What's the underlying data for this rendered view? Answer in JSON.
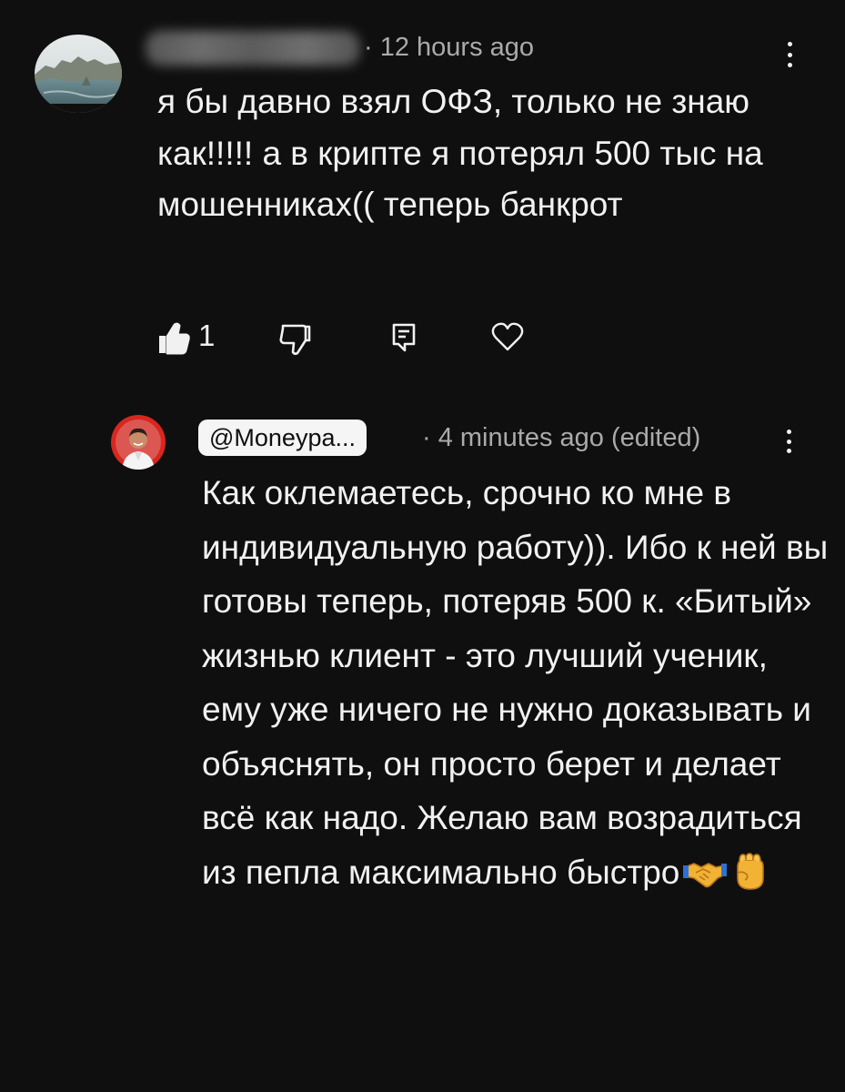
{
  "top_comment": {
    "meta": "· 12 hours ago",
    "text": "я бы давно взял ОФЗ, только не знаю как!!!!! а в крипте я потерял 500 тыс на мошенниках(( теперь банкрот",
    "like_count": "1",
    "icons": [
      "thumbs-up-icon",
      "thumbs-down-icon",
      "reply-icon",
      "heart-icon",
      "more-vert-icon"
    ]
  },
  "reply_comment": {
    "handle": "@Moneypa...",
    "meta": "· 4 minutes ago (edited)",
    "text": "Как оклемаетесь, срочно ко мне в индивидуальную работу)). Ибо к ней вы готовы теперь, потеряв 500 к. «Битый» жизнью клиент - это лучший ученик, ему уже ничего не нужно доказывать и объяснять, он просто берет и делает всё как надо. Желаю вам возрадиться из пепла максимально быстро",
    "emojis": [
      "handshake-emoji",
      "raised-fist-emoji"
    ],
    "icons": [
      "more-vert-icon"
    ]
  },
  "colors": {
    "background": "#0f0f0f",
    "primary_text": "#f1f1f1",
    "secondary_text": "#aaaaaa",
    "handle_chip_bg": "#f5f5f5",
    "avatar_reply_bg": "#d8271f"
  }
}
